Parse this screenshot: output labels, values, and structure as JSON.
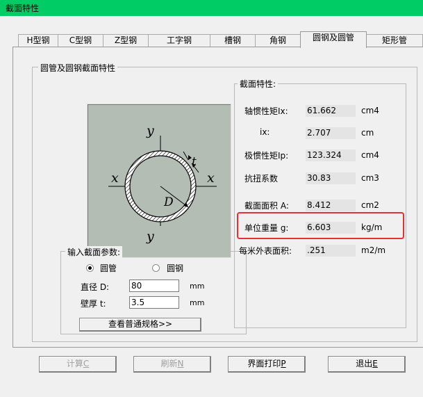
{
  "window": {
    "title": "截面特性"
  },
  "tabs": [
    {
      "label": "H型钢"
    },
    {
      "label": "C型钢"
    },
    {
      "label": "Z型钢"
    },
    {
      "label": "工字钢"
    },
    {
      "label": "槽钢"
    },
    {
      "label": "角钢"
    },
    {
      "label": "圆钢及圆管",
      "active": true
    },
    {
      "label": "矩形管"
    }
  ],
  "panel": {
    "title": "圆管及圆钢截面特性",
    "figure": {
      "axis_y": "y",
      "axis_x": "x",
      "diameter": "D",
      "thickness": "t"
    }
  },
  "inputs": {
    "title": "输入截面参数:",
    "radio_tube": "圆管",
    "radio_bar": "圆钢",
    "selected": "tube",
    "diameter_label": "直径 D:",
    "diameter_value": "80",
    "diameter_unit": "mm",
    "thickness_label": "壁厚 t:",
    "thickness_value": "3.5",
    "thickness_unit": "mm",
    "spec_button": "查看普通规格>>"
  },
  "properties": {
    "title": "截面特性:",
    "rows": [
      {
        "label": "轴惯性矩Ix:",
        "value": "61.662",
        "unit": "cm4"
      },
      {
        "label": "ix:",
        "value": "2.707",
        "unit": "cm"
      },
      {
        "label": "极惯性矩Ip:",
        "value": "123.324",
        "unit": "cm4"
      },
      {
        "label": "抗扭系数",
        "value": "30.83",
        "unit": "cm3"
      },
      {
        "label": "截面面积 A:",
        "value": "8.412",
        "unit": "cm2"
      },
      {
        "label": "单位重量 g:",
        "value": "6.603",
        "unit": "kg/m"
      },
      {
        "label": "每米外表面积:",
        "value": ".251",
        "unit": "m2/m"
      }
    ]
  },
  "buttons": {
    "calc": {
      "text": "计算",
      "key": "C"
    },
    "refresh": {
      "text": "刷新",
      "key": "N"
    },
    "print": {
      "text": "界面打印",
      "key": "P"
    },
    "exit": {
      "text": "退出",
      "key": "E"
    }
  },
  "colors": {
    "titlebar": "#00cc66",
    "highlight": "#e83030",
    "figure_bg": "#b4bdb4"
  }
}
